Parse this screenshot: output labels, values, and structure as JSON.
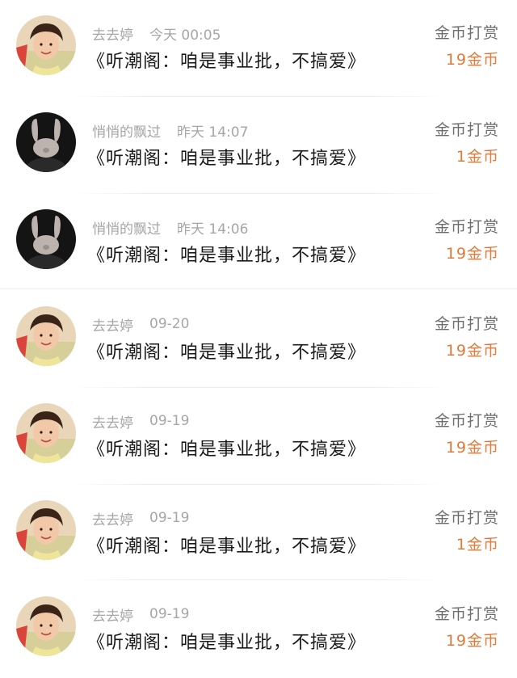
{
  "records": [
    {
      "user": "去去婷",
      "time": "今天 00:05",
      "book": "《听潮阁：咱是事业批，不搞爱》",
      "type": "金币打赏",
      "amount": "19金币",
      "avatar": "boy-photo-avatar"
    },
    {
      "user": "悄悄的飘过",
      "time": "昨天 14:07",
      "book": "《听潮阁：咱是事业批，不搞爱》",
      "type": "金币打赏",
      "amount": "1金币",
      "avatar": "bunny-avatar"
    },
    {
      "user": "悄悄的飘过",
      "time": "昨天 14:06",
      "book": "《听潮阁：咱是事业批，不搞爱》",
      "type": "金币打赏",
      "amount": "19金币",
      "avatar": "bunny-avatar"
    },
    {
      "user": "去去婷",
      "time": "09-20",
      "book": "《听潮阁：咱是事业批，不搞爱》",
      "type": "金币打赏",
      "amount": "19金币",
      "avatar": "boy-photo-avatar"
    },
    {
      "user": "去去婷",
      "time": "09-19",
      "book": "《听潮阁：咱是事业批，不搞爱》",
      "type": "金币打赏",
      "amount": "19金币",
      "avatar": "boy-photo-avatar"
    },
    {
      "user": "去去婷",
      "time": "09-19",
      "book": "《听潮阁：咱是事业批，不搞爱》",
      "type": "金币打赏",
      "amount": "1金币",
      "avatar": "boy-photo-avatar"
    },
    {
      "user": "去去婷",
      "time": "09-19",
      "book": "《听潮阁：咱是事业批，不搞爱》",
      "type": "金币打赏",
      "amount": "19金币",
      "avatar": "boy-photo-avatar"
    }
  ],
  "colors": {
    "amount": "#e07a3a",
    "meta": "#a6a6a6",
    "title": "#1a1a1a",
    "type": "#6e6e6e"
  }
}
